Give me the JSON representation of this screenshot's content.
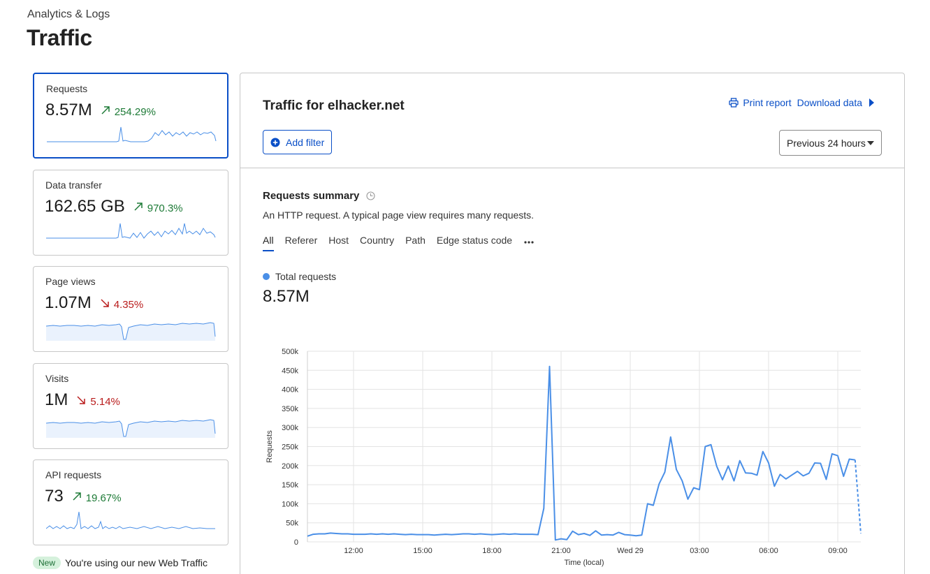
{
  "page": {
    "breadcrumb": "Analytics & Logs",
    "title": "Traffic"
  },
  "metrics": [
    {
      "label": "Requests",
      "value": "8.57M",
      "change": "254.29%",
      "direction": "up",
      "spark_icon": "trend-up-arrow-icon"
    },
    {
      "label": "Data transfer",
      "value": "162.65 GB",
      "change": "970.3%",
      "direction": "up",
      "spark_icon": "trend-up-arrow-icon"
    },
    {
      "label": "Page views",
      "value": "1.07M",
      "change": "4.35%",
      "direction": "down",
      "spark_icon": "trend-down-arrow-icon"
    },
    {
      "label": "Visits",
      "value": "1M",
      "change": "5.14%",
      "direction": "down",
      "spark_icon": "trend-down-arrow-icon"
    },
    {
      "label": "API requests",
      "value": "73",
      "change": "19.67%",
      "direction": "up",
      "spark_icon": "trend-up-arrow-icon"
    }
  ],
  "notice": {
    "badge": "New",
    "text": "You're using our new Web Traffic"
  },
  "panel": {
    "title": "Traffic for elhacker.net",
    "print_label": "Print report",
    "download_label": "Download data",
    "add_filter_label": "Add filter",
    "time_range": "Previous 24 hours"
  },
  "summary": {
    "title": "Requests summary",
    "description": "An HTTP request. A typical page view requires many requests.",
    "tabs": [
      "All",
      "Referer",
      "Host",
      "Country",
      "Path",
      "Edge status code"
    ],
    "active_tab": "All",
    "legend_label": "Total requests",
    "total_value": "8.57M"
  },
  "colors": {
    "accent": "#0a4fc7",
    "series": "#4a8fe7",
    "positive": "#1d7a36",
    "negative": "#b91c1c"
  },
  "chart_data": {
    "type": "line",
    "title": "",
    "xlabel": "Time (local)",
    "ylabel": "Requests",
    "ylim": [
      0,
      500000
    ],
    "y_ticks": [
      0,
      50000,
      100000,
      150000,
      200000,
      250000,
      300000,
      350000,
      400000,
      450000,
      500000
    ],
    "y_tick_labels": [
      "0",
      "50k",
      "100k",
      "150k",
      "200k",
      "250k",
      "300k",
      "350k",
      "400k",
      "450k",
      "500k"
    ],
    "x_ticks": [
      12,
      15,
      18,
      21,
      24,
      27,
      30,
      33
    ],
    "x_tick_labels": [
      "12:00",
      "15:00",
      "18:00",
      "21:00",
      "Wed 29",
      "03:00",
      "06:00",
      "09:00"
    ],
    "xlim": [
      10,
      34
    ],
    "grid": true,
    "series": [
      {
        "name": "Total requests",
        "x": [
          10.0,
          10.25,
          10.5,
          10.75,
          11.0,
          11.25,
          11.5,
          11.75,
          12.0,
          12.25,
          12.5,
          12.75,
          13.0,
          13.25,
          13.5,
          13.75,
          14.0,
          14.25,
          14.5,
          14.75,
          15.0,
          15.25,
          15.5,
          15.75,
          16.0,
          16.25,
          16.5,
          16.75,
          17.0,
          17.25,
          17.5,
          17.75,
          18.0,
          18.25,
          18.5,
          18.75,
          19.0,
          19.25,
          19.5,
          19.75,
          20.0,
          20.25,
          20.5,
          20.75,
          21.0,
          21.25,
          21.5,
          21.75,
          22.0,
          22.25,
          22.5,
          22.75,
          23.0,
          23.25,
          23.5,
          23.75,
          24.0,
          24.25,
          24.5,
          24.75,
          25.0,
          25.25,
          25.5,
          25.75,
          26.0,
          26.25,
          26.5,
          26.75,
          27.0,
          27.25,
          27.5,
          27.75,
          28.0,
          28.25,
          28.5,
          28.75,
          29.0,
          29.25,
          29.5,
          29.75,
          30.0,
          30.25,
          30.5,
          30.75,
          31.0,
          31.25,
          31.5,
          31.75,
          32.0,
          32.25,
          32.5,
          32.75,
          33.0,
          33.25,
          33.5,
          33.75
        ],
        "values": [
          15000,
          20000,
          21000,
          21000,
          23000,
          22000,
          21000,
          21000,
          20000,
          20000,
          20000,
          21000,
          20000,
          21000,
          20000,
          21000,
          20000,
          19000,
          20000,
          19000,
          19000,
          19000,
          18000,
          19000,
          20000,
          19000,
          20000,
          21000,
          21000,
          20000,
          21000,
          20000,
          19000,
          20000,
          21000,
          20000,
          21000,
          20000,
          20000,
          20000,
          19000,
          88000,
          460000,
          5000,
          8000,
          6000,
          28000,
          19000,
          22000,
          17000,
          29000,
          18000,
          19000,
          18000,
          25000,
          19000,
          18000,
          16000,
          18000,
          100000,
          96000,
          152000,
          183000,
          275000,
          190000,
          160000,
          112000,
          142000,
          137000,
          250000,
          255000,
          198000,
          163000,
          199000,
          160000,
          213000,
          181000,
          180000,
          175000,
          237000,
          207000,
          146000,
          177000,
          165000,
          175000,
          185000,
          173000,
          180000,
          207000,
          206000,
          164000,
          231000,
          226000,
          172000,
          217000,
          215000
        ],
        "projected_tail": {
          "x": [
            33.75,
            34.0
          ],
          "values": [
            215000,
            22000
          ]
        }
      }
    ]
  }
}
